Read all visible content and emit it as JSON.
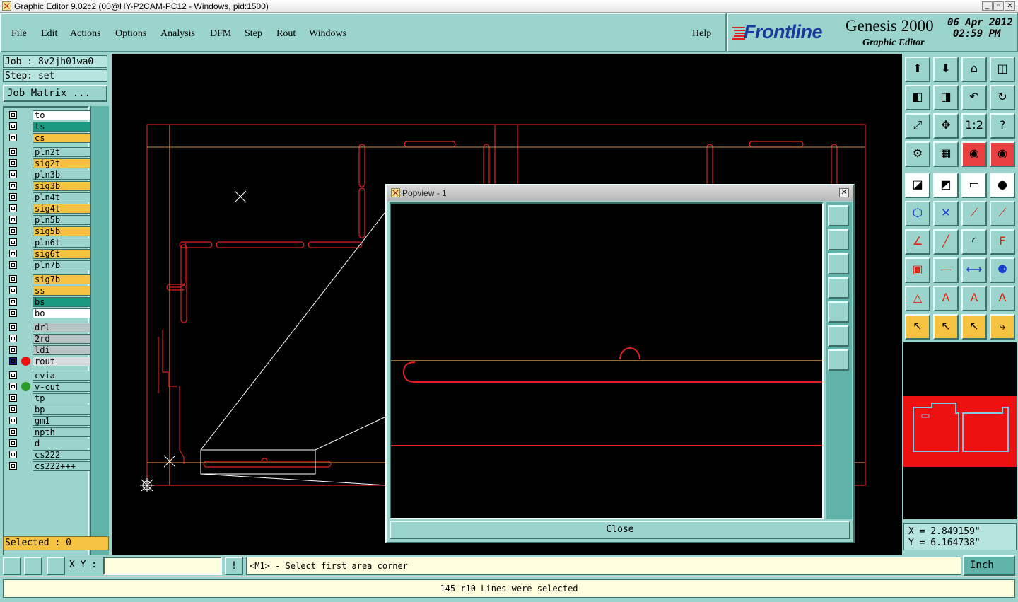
{
  "window": {
    "title": "Graphic Editor 9.02c2 (00@HY-P2CAM-PC12 - Windows, pid:1500)",
    "controls": [
      "_",
      "▫",
      "✕"
    ]
  },
  "menu": {
    "items": [
      {
        "label": "File"
      },
      {
        "label": "Edit"
      },
      {
        "label": "Actions"
      },
      {
        "label": "Options"
      },
      {
        "label": "Analysis"
      },
      {
        "label": "DFM"
      },
      {
        "label": "Step"
      },
      {
        "label": "Rout"
      },
      {
        "label": "Windows"
      }
    ],
    "help": "Help"
  },
  "brand": {
    "logo": "Frontline",
    "product": "Genesis 2000",
    "subtitle": "Graphic Editor",
    "date": "06 Apr 2012",
    "time": "02:59 PM"
  },
  "job": {
    "job_label": "Job : 8v2jh01wa0",
    "step_label": "Step: set",
    "matrix_button": "Job Matrix ..."
  },
  "layers": [
    {
      "name": "to",
      "color": "#ffffff"
    },
    {
      "name": "ts",
      "color": "#1a9a80"
    },
    {
      "name": "cs",
      "color": "#f5c242"
    },
    {
      "name": "pln2t",
      "color": "#9ad4cc"
    },
    {
      "name": "sig2t",
      "color": "#f5c242"
    },
    {
      "name": "pln3b",
      "color": "#9ad4cc"
    },
    {
      "name": "sig3b",
      "color": "#f5c242"
    },
    {
      "name": "pln4t",
      "color": "#9ad4cc"
    },
    {
      "name": "sig4t",
      "color": "#f5c242"
    },
    {
      "name": "pln5b",
      "color": "#9ad4cc"
    },
    {
      "name": "sig5b",
      "color": "#f5c242"
    },
    {
      "name": "pln6t",
      "color": "#9ad4cc"
    },
    {
      "name": "sig6t",
      "color": "#f5c242"
    },
    {
      "name": "pln7b",
      "color": "#9ad4cc"
    },
    {
      "name": "sig7b",
      "color": "#f5c242"
    },
    {
      "name": "ss",
      "color": "#f5c242"
    },
    {
      "name": "bs",
      "color": "#1a9a80"
    },
    {
      "name": "bo",
      "color": "#ffffff"
    },
    {
      "name": "drl",
      "color": "#b8c4c4"
    },
    {
      "name": "2rd",
      "color": "#b8c4c4"
    },
    {
      "name": "ldi",
      "color": "#b8c4c4"
    },
    {
      "name": "rout",
      "color": "#d8dcdc",
      "active": true,
      "dot": "#ee1111"
    },
    {
      "name": "cvia",
      "color": "#9ad4cc"
    },
    {
      "name": "v-cut",
      "color": "#9ad4cc",
      "dot": "#2a9a2a"
    },
    {
      "name": "tp",
      "color": "#9ad4cc"
    },
    {
      "name": "bp",
      "color": "#9ad4cc"
    },
    {
      "name": "gm1",
      "color": "#9ad4cc"
    },
    {
      "name": "npth",
      "color": "#9ad4cc"
    },
    {
      "name": "d",
      "color": "#9ad4cc"
    },
    {
      "name": "cs222",
      "color": "#9ad4cc"
    },
    {
      "name": "cs222+++",
      "color": "#9ad4cc"
    }
  ],
  "selected": "Selected : 0",
  "popview": {
    "title": "Popview - 1",
    "close_label": "Close"
  },
  "coords": {
    "x": "X = 2.849159\"",
    "y": "Y = 6.164738\""
  },
  "command": {
    "xy_label": "X Y :",
    "xy_value": "",
    "bang": "!",
    "prompt": "<M1> - Select first area corner",
    "unit": "Inch"
  },
  "status": "145 r10 Lines were selected",
  "toolbar_icons": [
    "zoom-home-icon",
    "view-up-icon",
    "home-icon",
    "split-view-icon",
    "pan-left-icon",
    "pan-right-icon",
    "undo-view-icon",
    "redraw-icon",
    "zoom-fit-icon",
    "zoom-center-icon",
    "scale-1-2-icon",
    "help-icon",
    "measure-tool-icon",
    "grid-icon",
    "layer-colors-icon",
    "layer-colors-alt-icon",
    "snap-icon",
    "feature-select-icon",
    "ruler-icon",
    "pad-icon",
    "node-connect-icon",
    "feature-x-icon",
    "line-add-icon",
    "line-extend-icon",
    "angle-icon",
    "line-draw-icon",
    "arc-icon",
    "text-f-icon",
    "pad-add-icon",
    "line-h-icon",
    "resize-icon",
    "circles-icon",
    "triangle-icon",
    "triangle-a-icon",
    "triangle-a2-icon",
    "triangle-a3-icon",
    "pointer-icon",
    "pointer-box-icon",
    "pointer-box2-icon",
    "route-select-icon"
  ],
  "colors": {
    "panel": "#9ad4cc",
    "accent_yellow": "#f5c242",
    "rout": "#ee1111"
  }
}
